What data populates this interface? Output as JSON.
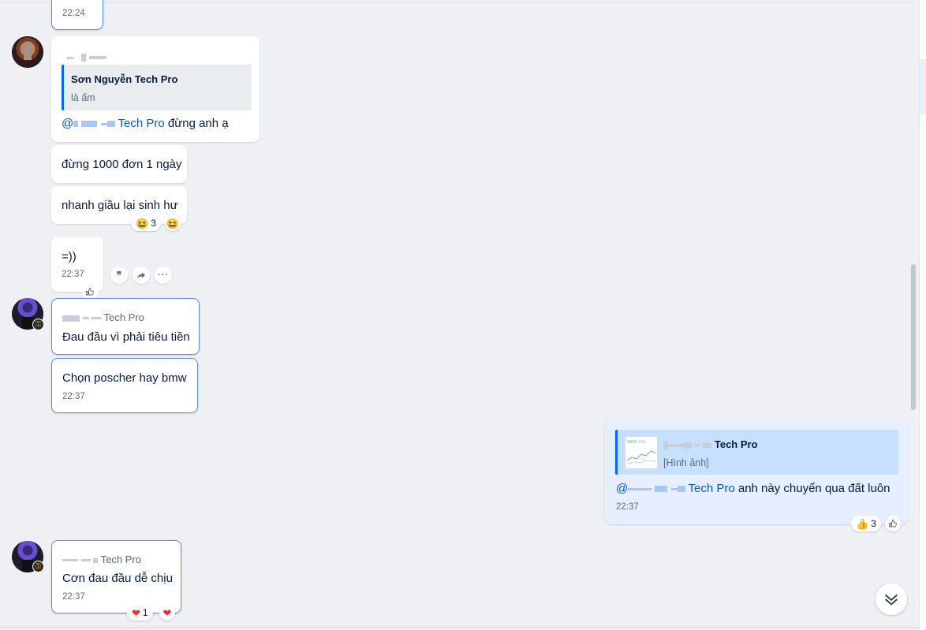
{
  "messages": {
    "first_time": "22:24",
    "reply_sender_name": "",
    "reply_quote": {
      "name": "Sơn Nguyễn Tech Pro",
      "text": "là ấm"
    },
    "reply_mention_suffix": "Tech Pro",
    "reply_text": " đừng anh ạ",
    "msg_1000": "đừng 1000 đơn 1 ngày",
    "msg_rich": "nhanh giầu lại sinh hư",
    "msg_rich_reaction": {
      "emoji": "laugh",
      "count": "3"
    },
    "msg_smile": "=))",
    "msg_smile_time": "22:37",
    "group2_sender_suffix": "Tech Pro",
    "msg_headache": "Đau đầu vì phải tiêu tiền",
    "msg_car": "Chọn poscher hay bmw",
    "msg_car_time": "22:37",
    "mine_quote": {
      "name_suffix": "Tech Pro",
      "text": "[Hình ảnh]"
    },
    "mine_mention_suffix": "Tech Pro",
    "mine_text": " anh này chuyển qua đất luôn",
    "mine_time": "22:37",
    "mine_reaction": {
      "emoji": "thumbs-up",
      "count": "3"
    },
    "group3_sender_suffix": "Tech Pro",
    "msg_easy": "Cơn đau đầu dễ chịu",
    "msg_easy_time": "22:37",
    "msg_easy_reaction": {
      "emoji": "heart",
      "count": "1"
    }
  },
  "actions": {
    "quote_icon": "quote-icon",
    "forward_icon": "forward-icon",
    "more_icon": "more-icon"
  },
  "colors": {
    "accent": "#0068ff",
    "mention": "#005ae0",
    "mine_bubble": "#e5efff",
    "background": "#eef0f4"
  }
}
